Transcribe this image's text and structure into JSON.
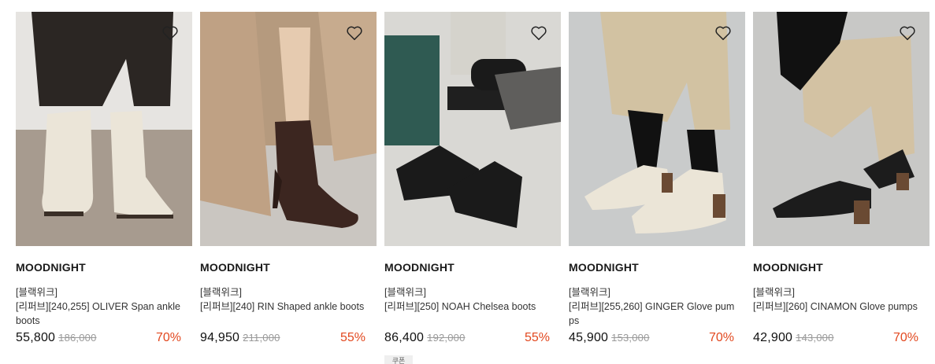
{
  "products": [
    {
      "brand": "MOODNIGHT",
      "tag": "[블랙위크]",
      "name": "[리퍼브][240,255] OLIVER Span ankle boots",
      "price": "55,800",
      "original_price": "186,000",
      "discount": "70%",
      "wishlist_icon": "heart-outline-icon"
    },
    {
      "brand": "MOODNIGHT",
      "tag": "[블랙위크]",
      "name": "[리퍼브][240] RIN Shaped ankle boots",
      "price": "94,950",
      "original_price": "211,000",
      "discount": "55%",
      "wishlist_icon": "heart-outline-icon"
    },
    {
      "brand": "MOODNIGHT",
      "tag": "[블랙위크]",
      "name": "[리퍼브][250] NOAH Chelsea boots",
      "price": "86,400",
      "original_price": "192,000",
      "discount": "55%",
      "coupon": "쿠폰",
      "wishlist_icon": "heart-outline-icon"
    },
    {
      "brand": "MOODNIGHT",
      "tag": "[블랙위크]",
      "name": "[리퍼브][255,260] GINGER Glove pumps",
      "price": "45,900",
      "original_price": "153,000",
      "discount": "70%",
      "wishlist_icon": "heart-outline-icon"
    },
    {
      "brand": "MOODNIGHT",
      "tag": "[블랙위크]",
      "name": "[리퍼브][260] CINAMON Glove pumps",
      "price": "42,900",
      "original_price": "143,000",
      "discount": "70%",
      "wishlist_icon": "heart-outline-icon"
    }
  ],
  "colors": {
    "discount": "#e2481f",
    "original_price": "#9a9a9a"
  }
}
